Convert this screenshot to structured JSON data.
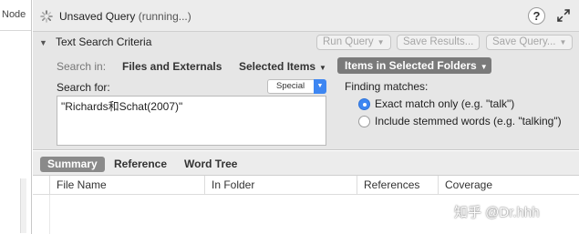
{
  "left_panel": {
    "column_header": "Node"
  },
  "titlebar": {
    "title": "Unsaved Query",
    "status": "(running...)",
    "help_label": "?"
  },
  "criteria": {
    "title": "Text Search Criteria",
    "buttons": {
      "run_query": "Run Query",
      "save_results": "Save Results...",
      "save_query": "Save Query..."
    },
    "search_in_label": "Search in:",
    "scopes": [
      "Files and Externals",
      "Selected Items",
      "Items in Selected Folders"
    ],
    "active_scope": "Items in Selected Folders",
    "search_for_label": "Search for:",
    "special_label": "Special",
    "search_value": "\"Richards和Schat(2007)\"",
    "finding_matches_label": "Finding matches:",
    "match_options": [
      {
        "label": "Exact match only (e.g. \"talk\")",
        "selected": true
      },
      {
        "label": "Include stemmed words (e.g. \"talking\")",
        "selected": false
      }
    ]
  },
  "tabs": [
    "Summary",
    "Reference",
    "Word Tree"
  ],
  "active_tab": "Summary",
  "table": {
    "columns": [
      "File Name",
      "In Folder",
      "References",
      "Coverage"
    ]
  },
  "watermark": "知乎 @Dr.hhh",
  "colors": {
    "accent": "#3d86f2",
    "active_scope_bg": "#7a7a7a",
    "active_tab_bg": "#8a8a8a",
    "panel_bg": "#e6e6e6"
  }
}
